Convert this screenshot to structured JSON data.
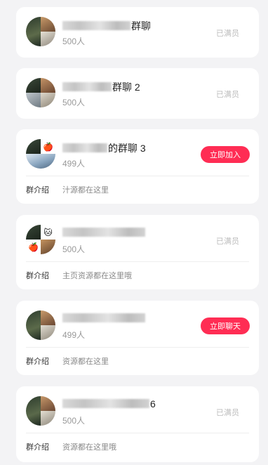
{
  "groups": [
    {
      "name_suffix": "群聊",
      "members": "500人",
      "status": "已满员",
      "intro_label": "",
      "intro": ""
    },
    {
      "name_suffix": "群聊 2",
      "members": "500人",
      "status": "已满员",
      "intro_label": "",
      "intro": ""
    },
    {
      "name_suffix": "的群聊 3",
      "members": "499人",
      "button": "立即加入",
      "intro_label": "群介绍",
      "intro": "汁源都在这里"
    },
    {
      "name_suffix": "",
      "members": "500人",
      "status": "已满员",
      "intro_label": "群介绍",
      "intro": "主页资源都在这里哦"
    },
    {
      "name_suffix": "",
      "members": "499人",
      "button": "立即聊天",
      "intro_label": "群介绍",
      "intro": "资源都在这里"
    },
    {
      "name_suffix": "6",
      "members": "500人",
      "status": "已满员",
      "intro_label": "群介绍",
      "intro": "资源都在这里哦"
    }
  ],
  "colors": {
    "accent": "#ff2d54",
    "background": "#f3f3f5",
    "muted": "#999999"
  }
}
